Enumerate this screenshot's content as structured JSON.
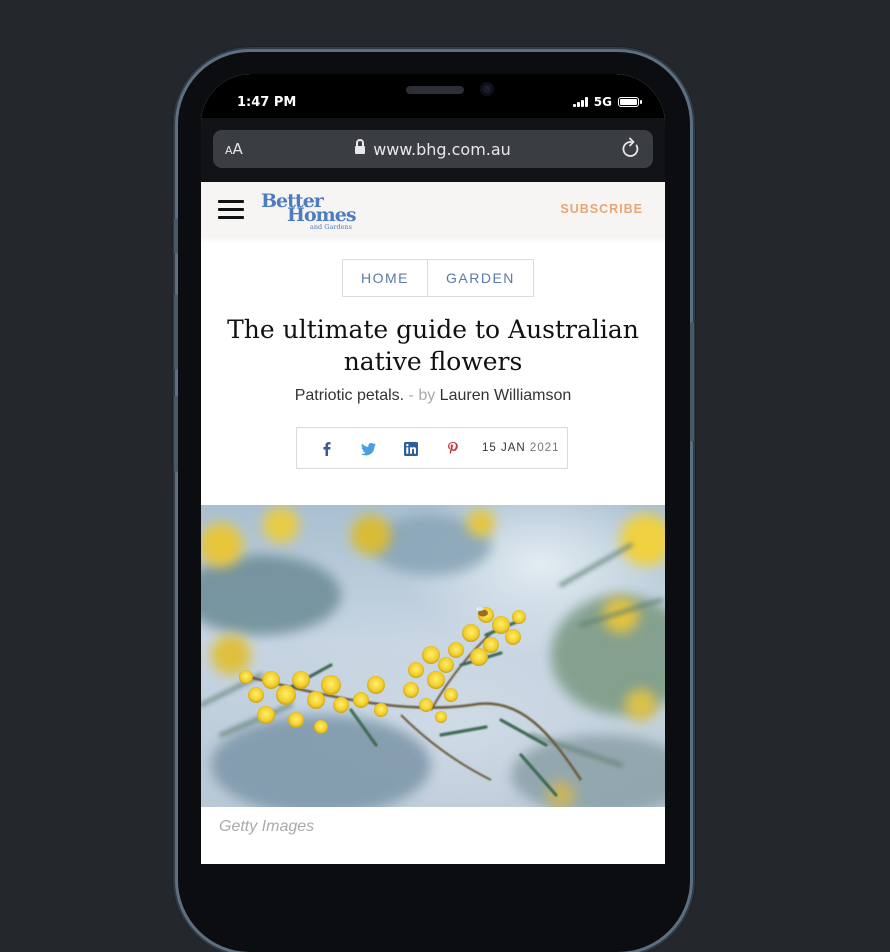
{
  "status": {
    "time": "1:47 PM",
    "network": "5G"
  },
  "browser": {
    "text_size_label": "AA",
    "url": "www.bhg.com.au"
  },
  "site": {
    "logo_line1": "Better",
    "logo_line2": "Homes",
    "logo_line3": "and Gardens",
    "subscribe_label": "SUBSCRIBE",
    "brand_color": "#4f7bc1",
    "accent_color": "#e6a67a"
  },
  "breadcrumbs": [
    {
      "label": "HOME"
    },
    {
      "label": "GARDEN"
    }
  ],
  "article": {
    "title_line1": "The ultimate guide to Australian",
    "title_line2": "native flowers",
    "subtitle": "Patriotic petals.",
    "by_label": "- by",
    "author": "Lauren Williamson",
    "date_day_month": "15 JAN",
    "date_year": "2021"
  },
  "share": [
    {
      "icon": "facebook-icon",
      "color": "#3b5998"
    },
    {
      "icon": "twitter-icon",
      "color": "#4aa0de"
    },
    {
      "icon": "linkedin-icon",
      "color": "#2a5f9c"
    },
    {
      "icon": "pinterest-icon",
      "color": "#c23a3a"
    }
  ],
  "hero": {
    "caption": "Getty Images"
  }
}
